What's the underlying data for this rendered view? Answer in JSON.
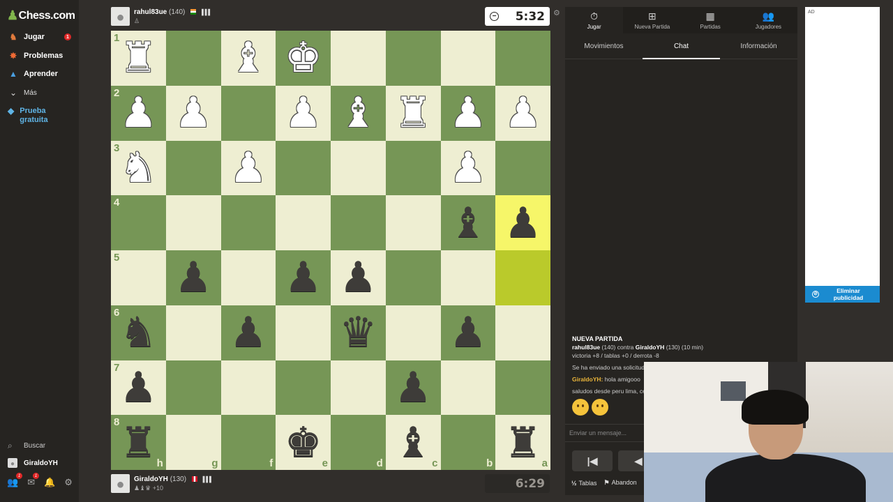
{
  "sidebar": {
    "logo": "Chess.com",
    "items": [
      {
        "label": "Jugar",
        "badge": "1"
      },
      {
        "label": "Problemas"
      },
      {
        "label": "Aprender"
      },
      {
        "label": "Más"
      }
    ],
    "promo": "Prueba gratuita",
    "search": "Buscar",
    "user": "GiraldoYH",
    "bottom_badges": {
      "friends": "1",
      "messages": "1"
    }
  },
  "top_player": {
    "name": "rahul83ue",
    "rating": "(140)",
    "clock": "5:32"
  },
  "bottom_player": {
    "name": "GiraldoYH",
    "rating": "(130)",
    "captured_adv": "+10",
    "clock": "6:29"
  },
  "board": {
    "ranks": [
      "1",
      "2",
      "3",
      "4",
      "5",
      "6",
      "7",
      "8"
    ],
    "files": [
      "h",
      "g",
      "f",
      "e",
      "d",
      "c",
      "b",
      "a"
    ],
    "rows": [
      [
        "wR",
        "",
        "wB",
        "wK",
        "",
        "",
        "",
        ""
      ],
      [
        "wP",
        "wP",
        "",
        "wP",
        "wB",
        "wR",
        "wP",
        "wP"
      ],
      [
        "wN",
        "",
        "wP",
        "",
        "",
        "",
        "wP",
        ""
      ],
      [
        "",
        "",
        "",
        "",
        "",
        "",
        "bB",
        "bP"
      ],
      [
        "",
        "bP",
        "",
        "bP",
        "bP",
        "",
        "",
        ""
      ],
      [
        "bN",
        "",
        "bP",
        "",
        "bQ",
        "",
        "bP",
        ""
      ],
      [
        "bP",
        "",
        "",
        "",
        "",
        "bP",
        "",
        ""
      ],
      [
        "bR",
        "",
        "",
        "bK",
        "",
        "bB",
        "",
        "bR"
      ]
    ],
    "highlight": {
      "from": "a5",
      "to": "a4"
    }
  },
  "panel": {
    "tabs": [
      "Jugar",
      "Nueva Partida",
      "Partidas",
      "Jugadores"
    ],
    "subtabs": [
      "Movimientos",
      "Chat",
      "Información"
    ],
    "chat": {
      "header": "NUEVA PARTIDA",
      "match_p1": "rahul83ue",
      "match_p1_rating": "(140)",
      "match_vs": "contra",
      "match_p2": "GiraldoYH",
      "match_p2_rating": "(130) (10 min)",
      "stakes": "victoria +8 / tablas +0 / derrota -8",
      "system_msg": "Se ha enviado una solicitud",
      "msg_user": "GiraldoYH:",
      "msg_text": "hola amigooo",
      "msg2": "saludos desde peru lima, ce"
    },
    "input_placeholder": "Enviar un mensaje...",
    "actions": {
      "draw": "Tablas",
      "resign": "Abandon"
    },
    "draw_icon": "½"
  },
  "ad": {
    "label": "AD",
    "remove": "Eliminar publicidad"
  },
  "colors": {
    "light": "#eeeed2",
    "dark": "#769656",
    "highlight_to": "#f6f669",
    "highlight_from": "#baca2b",
    "accent": "#81b64c"
  }
}
